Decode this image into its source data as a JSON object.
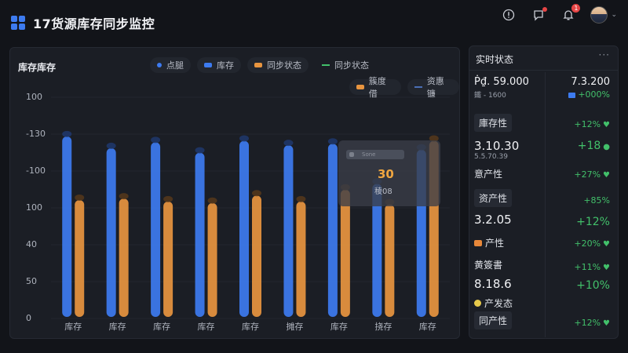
{
  "app": {
    "title": "17货源库存同步监控"
  },
  "header": {
    "notification_count": "1"
  },
  "chart_panel": {
    "title": "库存库存",
    "legend": [
      {
        "label": "点腿",
        "kind": "dot",
        "color": "#3d7bf0"
      },
      {
        "label": "库存",
        "kind": "bar",
        "color": "#3d7bf0"
      },
      {
        "label": "同步状态",
        "kind": "bar",
        "color": "#e8953f"
      },
      {
        "label": "同步状态",
        "kind": "line",
        "color": "#42c06a"
      }
    ],
    "legend2": [
      {
        "label": "簇度借",
        "kind": "bar",
        "color": "#e8953f"
      },
      {
        "label": "资惠镰",
        "kind": "line",
        "color": "#4a6fb5"
      }
    ],
    "tooltip": {
      "header": "Sone",
      "value": "30",
      "sub": "稜08"
    }
  },
  "chart_data": {
    "type": "bar",
    "yticks": [
      "100",
      "-130",
      "-100",
      "100",
      "40",
      "50",
      "0"
    ],
    "categories": [
      "库存",
      "库存",
      "库存",
      "库存",
      "库存",
      "摊存",
      "库存",
      "挠存",
      "库存"
    ],
    "series": [
      {
        "name": "库存",
        "color": "#3d7bf0",
        "values": [
          122,
          114,
          118,
          111,
          119,
          116,
          117,
          90,
          113
        ]
      },
      {
        "name": "同步状态",
        "color": "#e8953f",
        "values": [
          79,
          80,
          78,
          77,
          82,
          78,
          86,
          76,
          119
        ]
      }
    ],
    "ylim": [
      0,
      150
    ]
  },
  "status_panel": {
    "title": "实时状态",
    "more": "···",
    "rows": [
      {
        "left_main": "Ṗ₫. 59.000",
        "left_sub": "鐵 - 1600",
        "right_main": "7.3.200",
        "right_sub": "+000%"
      },
      {
        "left_label": "庫存性",
        "right": "+12%"
      },
      {
        "left_main": "3.10.30",
        "left_sub": "5.5.70.39",
        "right_main": "+18"
      },
      {
        "left_label": "意产性",
        "right": "+27%"
      },
      {
        "left_label": "资产性",
        "right": "+85%"
      },
      {
        "left_main": "3.2.05",
        "right": "+12%"
      },
      {
        "left_label": "产性",
        "right": "+20%"
      },
      {
        "left_label": "黄簽書",
        "right": "+11%"
      },
      {
        "left_main": "8.18.6",
        "right": "+10%"
      },
      {
        "left_label": "产发态"
      },
      {
        "left_label": "同产性",
        "right": "+12%"
      }
    ]
  }
}
